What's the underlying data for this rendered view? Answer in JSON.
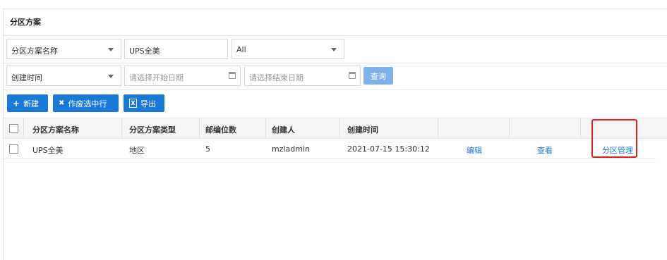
{
  "panel": {
    "title": "分区方案"
  },
  "filters": {
    "field_select": "分区方案名称",
    "name_value": "UPS全美",
    "type_select": "All",
    "time_select": "创建时间",
    "start_placeholder": "请选择开始日期",
    "end_placeholder": "请选择结束日期",
    "query_label": "查询"
  },
  "toolbar": {
    "add_label": "新建",
    "add_icon": "+",
    "void_label": "作废选中行",
    "void_icon": "✖",
    "export_label": "导出",
    "export_icon": "X"
  },
  "table": {
    "columns": [
      "分区方案名称",
      "分区方案类型",
      "邮编位数",
      "创建人",
      "创建时间"
    ],
    "rows": [
      {
        "name": "UPS全美",
        "type": "地区",
        "digits": "5",
        "creator": "mzladmin",
        "created_at": "2021-07-15 15:30:12",
        "edit": "编辑",
        "view": "查看",
        "manage": "分区管理"
      }
    ]
  },
  "colors": {
    "primary": "#1a78d6",
    "disabled": "#7db3ea",
    "highlight": "#e02020"
  }
}
